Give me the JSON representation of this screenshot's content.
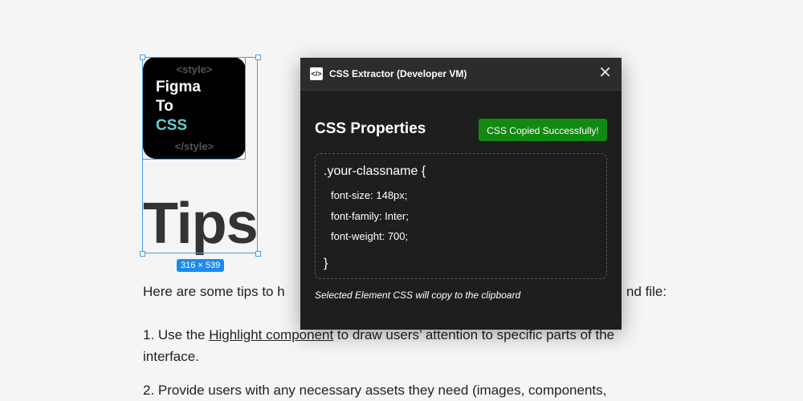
{
  "canvas": {
    "logo": {
      "open_tag": "<style>",
      "line1": "Figma",
      "line2": "To",
      "line3": "CSS",
      "close_tag": "</style>"
    },
    "heading": "Tips",
    "size_badge": "316 × 539",
    "paragraph_left": "Here are some tips to h",
    "paragraph_right": "nd file:",
    "item1_prefix": "1. Use the ",
    "item1_link": "Highlight component",
    "item1_suffix": " to draw users’ attention to specific parts of the",
    "item1_line2": "interface.",
    "item2": "2. Provide users with any necessary assets they need (images, components,"
  },
  "modal": {
    "title": "CSS Extractor (Developer VM)",
    "icon": "</>",
    "heading": "CSS Properties",
    "status_button": "CSS Copied Successfully!",
    "status_color": "#118a11",
    "code": {
      "selector": ".your-classname {",
      "properties": [
        "font-size: 148px;",
        "font-family: Inter;",
        "font-weight: 700;"
      ],
      "close": "}"
    },
    "note": "Selected Element CSS will copy to the clipboard"
  }
}
